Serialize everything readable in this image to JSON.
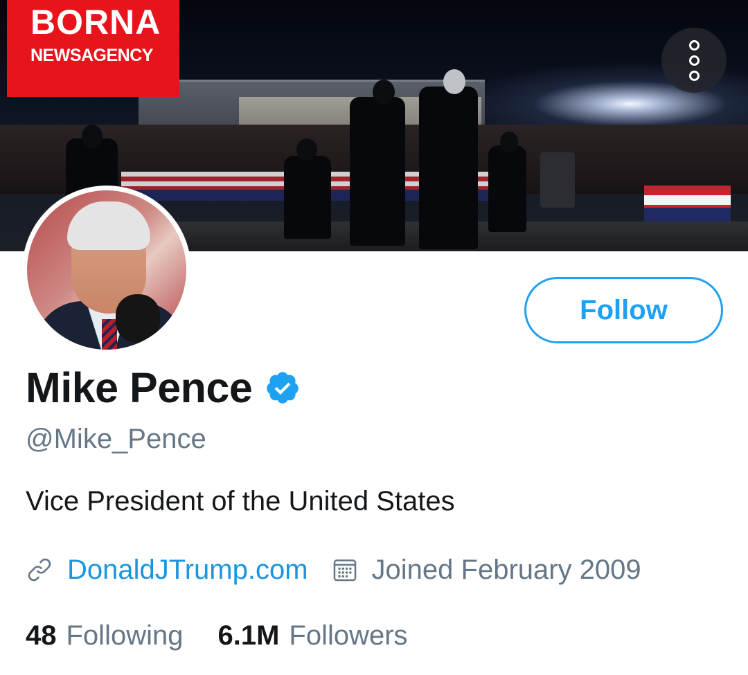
{
  "banner": {
    "logo_line1": "BORNA",
    "logo_line2": "NEWSAGENCY",
    "more_icon": "more-vertical-icon"
  },
  "profile": {
    "name": "Mike Pence",
    "verified_icon": "verified-badge-icon",
    "handle": "@Mike_Pence",
    "bio": "Vice President of the United States",
    "website": "DonaldJTrump.com",
    "website_icon": "link-icon",
    "joined": "Joined February 2009",
    "joined_icon": "calendar-icon"
  },
  "actions": {
    "follow_label": "Follow"
  },
  "stats": [
    {
      "value": "48",
      "label": "Following"
    },
    {
      "value": "6.1M",
      "label": "Followers"
    }
  ],
  "colors": {
    "accent": "#1da1f2",
    "link": "#1b95e0",
    "secondary_text": "#657786",
    "primary_text": "#14171a",
    "logo_red": "#e8141b"
  }
}
